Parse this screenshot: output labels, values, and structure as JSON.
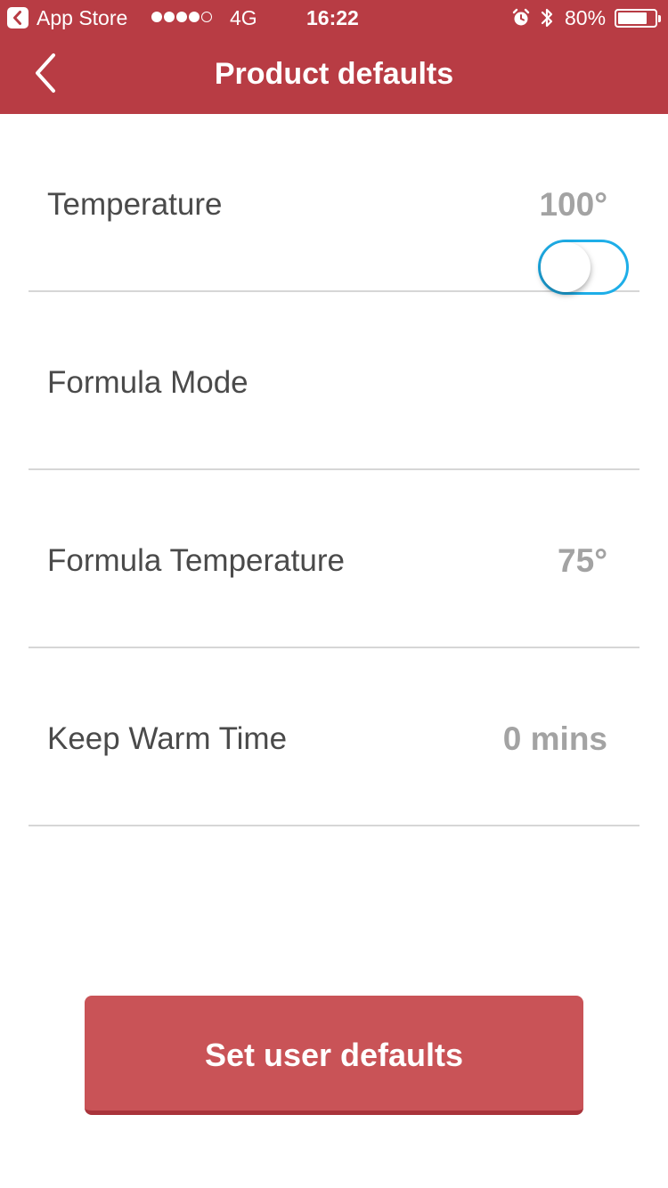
{
  "status_bar": {
    "back_app": "App Store",
    "network": "4G",
    "time": "16:22",
    "battery": "80%",
    "battery_level": 0.8,
    "signal_strength": 4,
    "icons": [
      "back-to-app-icon",
      "alarm-icon",
      "bluetooth-icon",
      "battery-icon"
    ]
  },
  "nav": {
    "title": "Product defaults",
    "back_icon": "chevron-left-icon"
  },
  "settings": [
    {
      "label": "Temperature",
      "value": "100°"
    },
    {
      "label": "Formula Mode",
      "toggle_on": false
    },
    {
      "label": "Formula Temperature",
      "value": "75°"
    },
    {
      "label": "Keep Warm Time",
      "value": "0 mins"
    }
  ],
  "action": {
    "label": "Set user defaults"
  },
  "colors": {
    "header": "#b83c44",
    "button": "#c95357",
    "toggle_border": "#1eaee8",
    "label": "#4a4a4a",
    "value": "#a3a3a3"
  }
}
